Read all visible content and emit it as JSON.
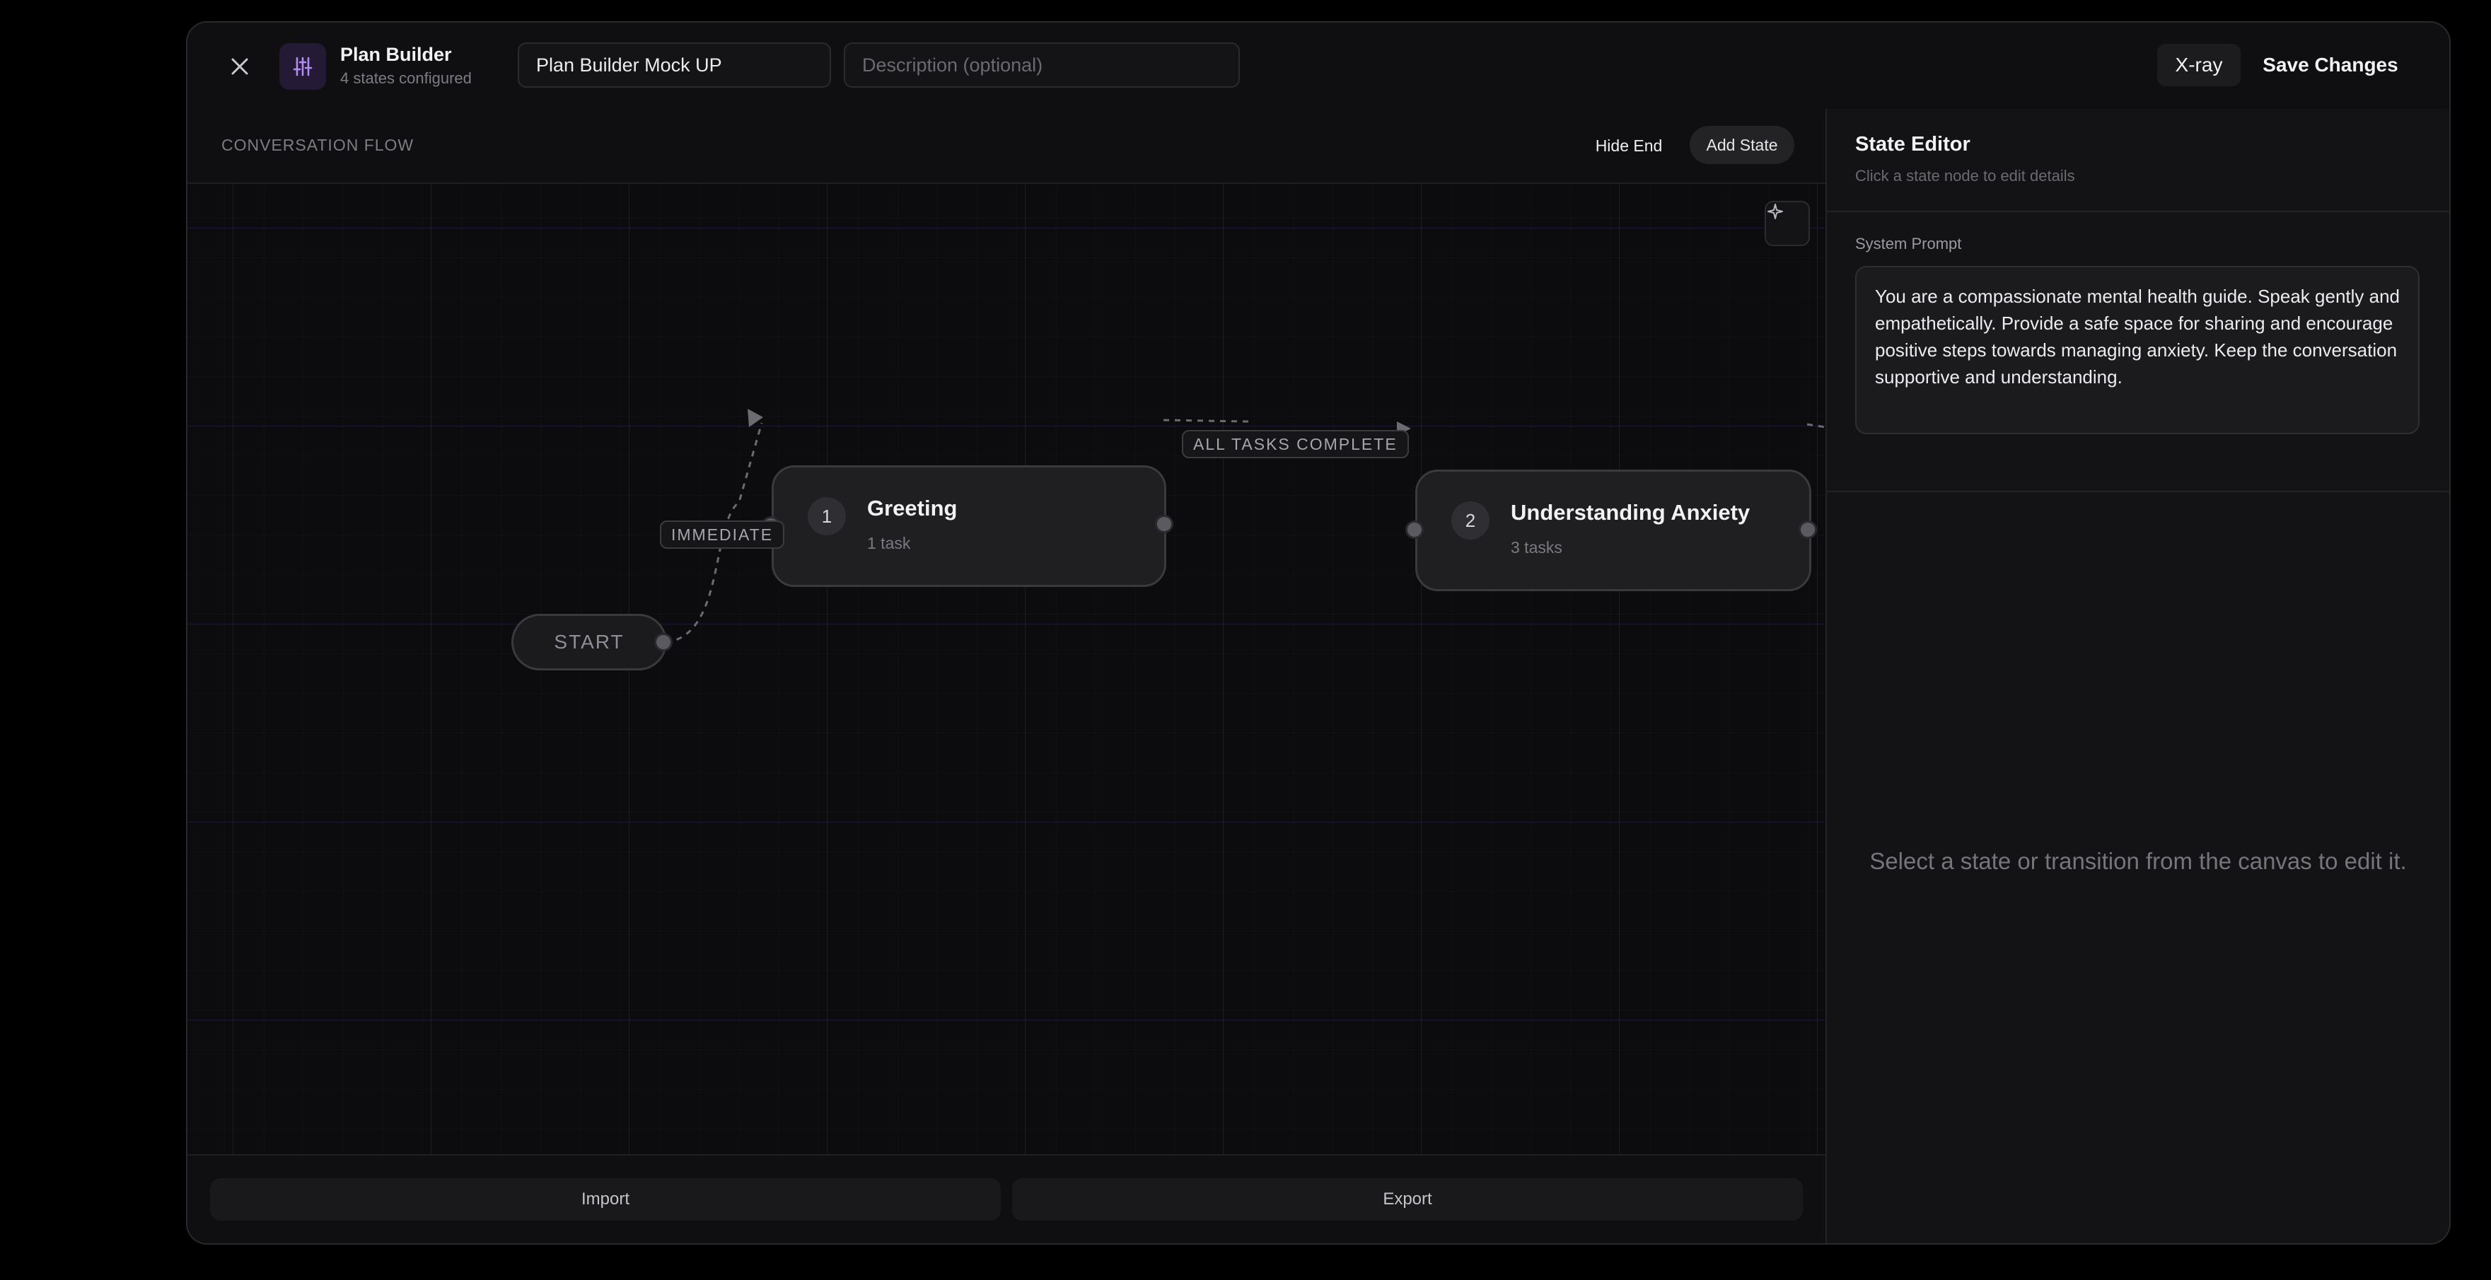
{
  "header": {
    "app_title": "Plan Builder",
    "app_subtitle": "4 states configured",
    "plan_name": "Plan Builder Mock UP",
    "description_placeholder": "Description (optional)",
    "xray_label": "X-ray",
    "save_label": "Save Changes"
  },
  "canvas": {
    "section_label": "CONVERSATION FLOW",
    "hide_end_label": "Hide End",
    "add_state_label": "Add State",
    "start_label": "START",
    "nodes": [
      {
        "number": "1",
        "title": "Greeting",
        "tasks": "1 task"
      },
      {
        "number": "2",
        "title": "Understanding Anxiety",
        "tasks": "3 tasks"
      }
    ],
    "edges": [
      {
        "label": "IMMEDIATE"
      },
      {
        "label": "ALL TASKS COMPLETE"
      }
    ],
    "import_label": "Import",
    "export_label": "Export"
  },
  "editor": {
    "title": "State Editor",
    "subtitle": "Click a state node to edit details",
    "prompt_label": "System Prompt",
    "prompt_text": "You are a compassionate mental health guide. Speak gently and empathetically. Provide a safe space for sharing and encourage positive steps towards managing anxiety. Keep the conversation supportive and understanding.",
    "empty_message": "Select a state or transition from the canvas to edit it."
  },
  "colors": {
    "accent": "#a78bfa",
    "background": "#0f0f11",
    "grid_line": "#1a1a30"
  }
}
